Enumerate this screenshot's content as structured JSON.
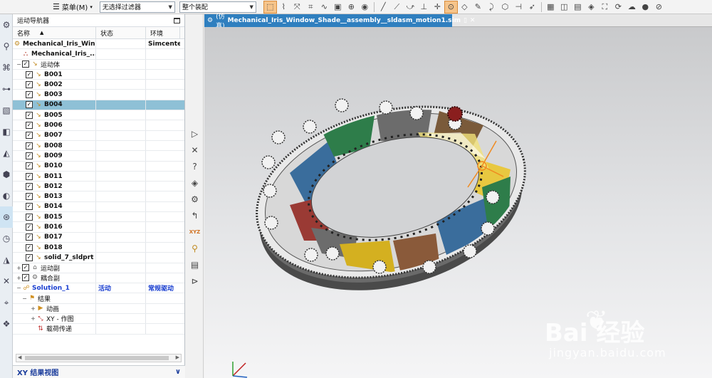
{
  "toolbar": {
    "menu_label": "菜单(M)",
    "filter_dropdown": "无选择过滤器",
    "assembly_dropdown": "整个装配"
  },
  "navigator": {
    "title": "运动导航器",
    "columns": {
      "name": "名称",
      "status": "状态",
      "env": "环境"
    },
    "root_name": "Mechanical_Iris_Win...",
    "root_env": "Simcenter",
    "model_name": "Mechanical_Iris_...",
    "motion_bodies_label": "运动体",
    "bodies": [
      "B001",
      "B002",
      "B003",
      "B004",
      "B005",
      "B006",
      "B007",
      "B008",
      "B009",
      "B010",
      "B011",
      "B012",
      "B013",
      "B014",
      "B015",
      "B016",
      "B017",
      "B018",
      "solid_7_sldprt"
    ],
    "selected_body": "B004",
    "joints_label": "运动副",
    "couplers_label": "耦合副",
    "solution_name": "Solution_1",
    "solution_status": "活动",
    "solution_env": "常规驱动",
    "results_label": "结果",
    "animation_label": "动画",
    "xy_plot_label": "XY - 作图",
    "load_transfer_label": "载荷传递",
    "xy_result_view": "XY 结果视图"
  },
  "viewport": {
    "tab_prefix": "(仿真)",
    "tab_title": "Mechanical_Iris_Window_Shade__assembly__sldasm_motion1.sim",
    "watermark_text": "Bai 经验",
    "watermark_url": "jingyan.baidu.com"
  },
  "colors": {
    "accent": "#2f7fbf",
    "selection": "#8ec0d6",
    "solution_blue": "#1a3fd0",
    "blade_colors": [
      "#2e7d4a",
      "#3a6d9c",
      "#9a3a34",
      "#d4b020",
      "#7a5a3a",
      "#6c6c6c",
      "#c0c0c0"
    ]
  }
}
